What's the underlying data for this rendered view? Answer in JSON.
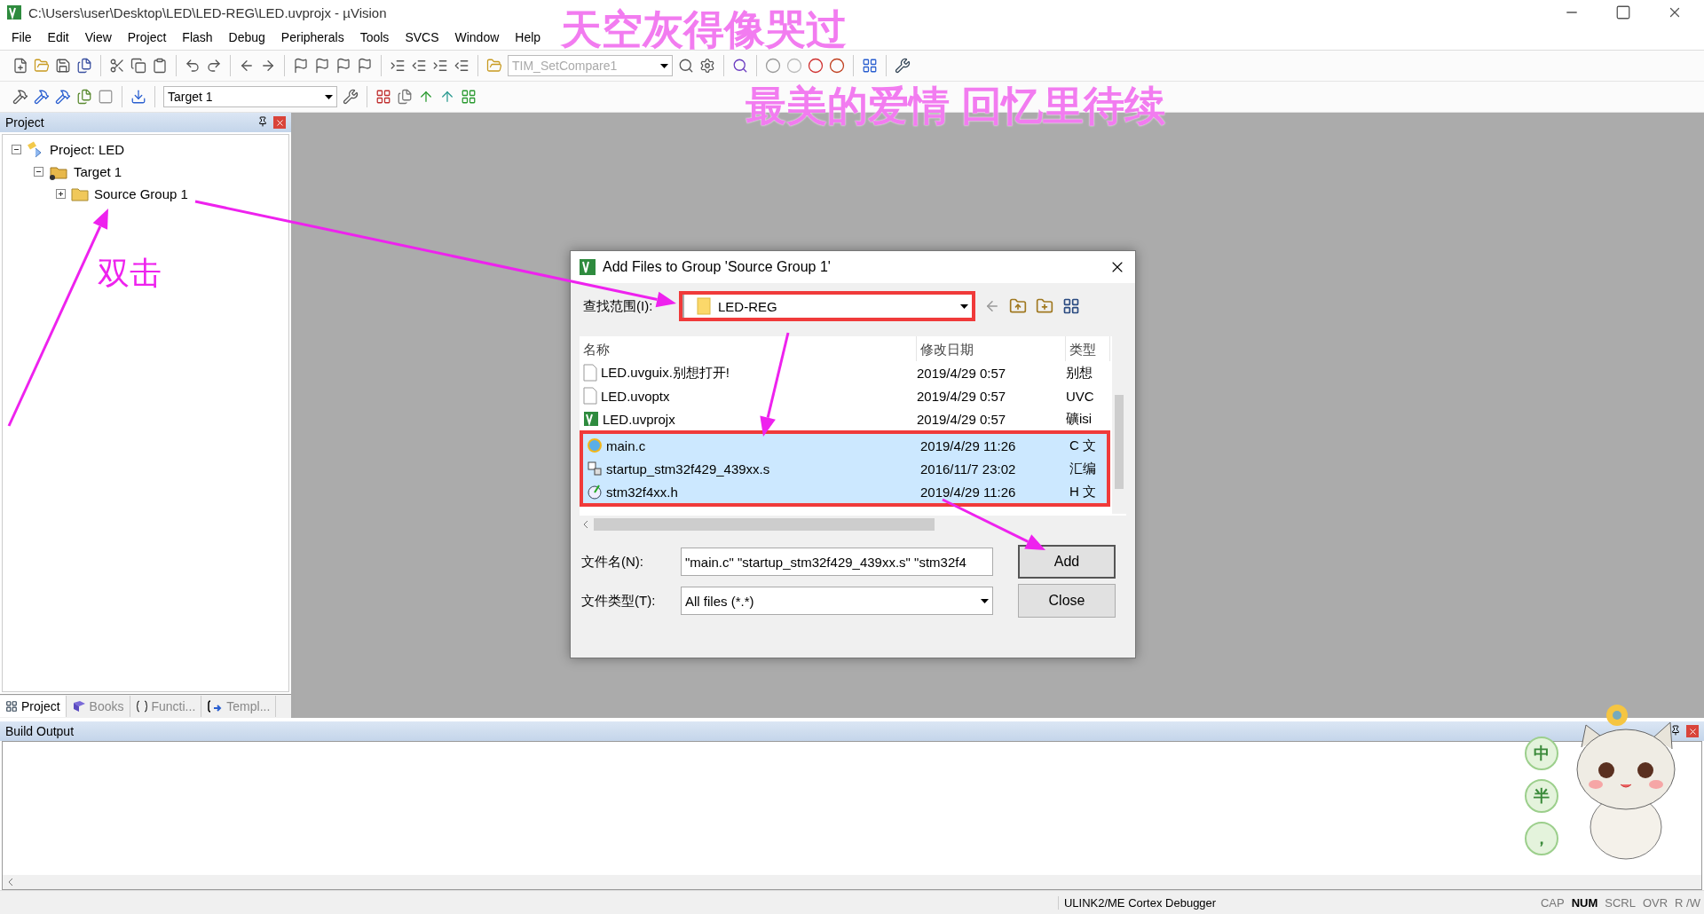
{
  "window": {
    "title": "C:\\Users\\user\\Desktop\\LED\\LED-REG\\LED.uvprojx - µVision"
  },
  "menu": [
    "File",
    "Edit",
    "View",
    "Project",
    "Flash",
    "Debug",
    "Peripherals",
    "Tools",
    "SVCS",
    "Window",
    "Help"
  ],
  "toolbar": {
    "function_combo": "TIM_SetCompare1"
  },
  "build_toolbar": {
    "target": "Target 1"
  },
  "project_panel": {
    "title": "Project",
    "tree": [
      {
        "label": "Project: LED",
        "kind": "project",
        "expanded": true,
        "children": [
          {
            "label": "Target 1",
            "kind": "target",
            "expanded": true,
            "children": [
              {
                "label": "Source Group 1",
                "kind": "group",
                "expanded": false
              }
            ]
          }
        ]
      }
    ],
    "tabs": [
      {
        "label": "Project",
        "kind": "project",
        "selected": true
      },
      {
        "label": "Books",
        "kind": "books",
        "selected": false
      },
      {
        "label": "Functi...",
        "kind": "functions",
        "selected": false
      },
      {
        "label": "Templ...",
        "kind": "templates",
        "selected": false
      }
    ]
  },
  "dialog": {
    "title": "Add Files to Group 'Source Group 1'",
    "look_in_label": "查找范围(I):",
    "look_in": "LED-REG",
    "columns": [
      "名称",
      "修改日期",
      "类型"
    ],
    "files": [
      {
        "name": "LED.uvguix.别想打开!",
        "date": "2019/4/29 0:57",
        "type": "别想",
        "kind": "blank",
        "selected": false
      },
      {
        "name": "LED.uvoptx",
        "date": "2019/4/29 0:57",
        "type": "UVC",
        "kind": "blank",
        "selected": false
      },
      {
        "name": "LED.uvprojx",
        "date": "2019/4/29 0:57",
        "type": "礦isi",
        "kind": "uvision",
        "selected": false
      },
      {
        "name": "main.c",
        "date": "2019/4/29 11:26",
        "type": "C 文",
        "kind": "browser",
        "selected": true
      },
      {
        "name": "startup_stm32f429_439xx.s",
        "date": "2016/11/7 23:02",
        "type": "汇编",
        "kind": "asm",
        "selected": true
      },
      {
        "name": "stm32f4xx.h",
        "date": "2019/4/29 11:26",
        "type": "H 文",
        "kind": "header",
        "selected": true
      }
    ],
    "filename_label": "文件名(N):",
    "filename": "\"main.c\" \"startup_stm32f429_439xx.s\" \"stm32f4",
    "filetype_label": "文件类型(T):",
    "filetype": "All files (*.*)",
    "buttons": [
      {
        "label": "Add",
        "default": true
      },
      {
        "label": "Close",
        "default": false
      }
    ]
  },
  "build_output": {
    "title": "Build Output"
  },
  "status_bar": {
    "debugger": "ULINK2/ME Cortex Debugger",
    "indicators": [
      {
        "label": "CAP",
        "on": false
      },
      {
        "label": "NUM",
        "on": true
      },
      {
        "label": "SCRL",
        "on": false
      },
      {
        "label": "OVR",
        "on": false
      },
      {
        "label": "R /W",
        "on": false
      }
    ]
  },
  "annotation": {
    "note": "双击"
  },
  "lyrics_overlay": [
    "天空灰得像哭过",
    "最美的爱情 回忆里待续"
  ],
  "ime_widget": [
    "中",
    "半",
    "，"
  ]
}
